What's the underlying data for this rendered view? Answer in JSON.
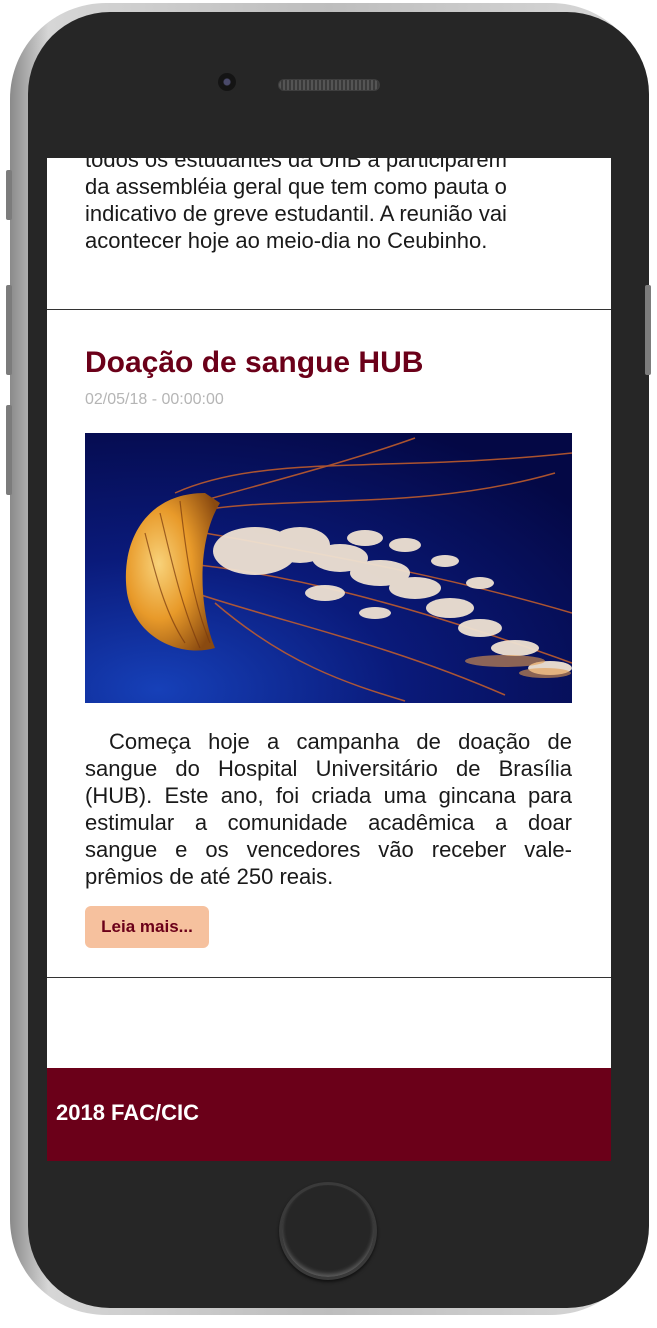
{
  "previous_post": {
    "text_lines": [
      "todos os estudantes da UnB a participarem",
      "da assembléia geral que tem como pauta o",
      "indicativo de greve estudantil. A reunião vai",
      "acontecer hoje ao meio-dia no Ceubinho."
    ]
  },
  "post": {
    "title": "Doação de sangue HUB",
    "date": "02/05/18 - 00:00:00",
    "image_alt": "jellyfish",
    "text": "Começa hoje a campanha de doação de sangue do Hospital Universitário de Brasília (HUB). Este ano, foi criada uma gincana para estimular a comunidade acadêmica a doar sangue e os vencedores vão receber vale-prêmios de até 250 reais.",
    "read_more_label": "Leia mais..."
  },
  "footer": {
    "text": "2018 FAC/CIC"
  },
  "colors": {
    "brand": "#6b0019",
    "button_bg": "#f6c19e",
    "date_gray": "#b5b5b5"
  }
}
